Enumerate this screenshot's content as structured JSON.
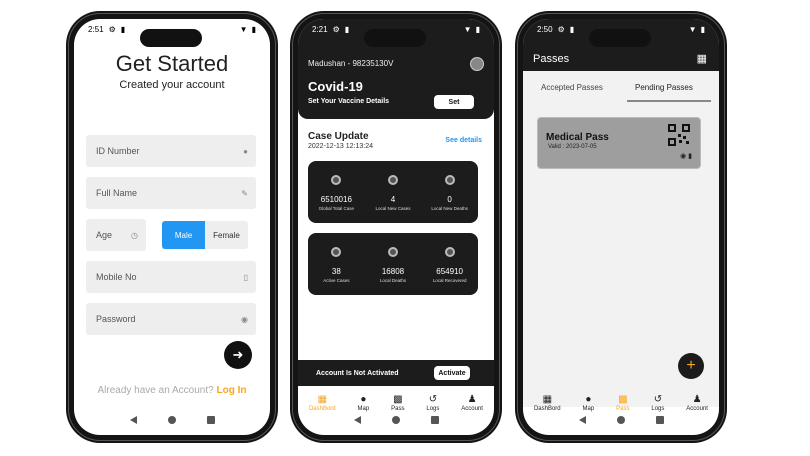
{
  "screens": {
    "signup": {
      "status": {
        "time": "2:51"
      },
      "title": "Get Started",
      "subtitle": "Created your account",
      "fields": {
        "id_number": "ID Number",
        "full_name": "Full Name",
        "age": "Age",
        "mobile": "Mobile No",
        "password": "Password"
      },
      "gender": {
        "male": "Male",
        "female": "Female",
        "selected": "Male"
      },
      "login_prompt": "Already have an Account?",
      "login_link": "Log In"
    },
    "dashboard": {
      "status": {
        "time": "2:21"
      },
      "user": "Madushan -   98235130V",
      "title": "Covid-19",
      "vaccine_label": "Set Your Vaccine Details",
      "set_button": "Set",
      "case_update": {
        "title": "Case Update",
        "date": "2022-12-13 12:13:24",
        "details_link": "See details"
      },
      "stats_row1": [
        {
          "value": "6510016",
          "label": "Global Total Case"
        },
        {
          "value": "4",
          "label": "Local New Cases"
        },
        {
          "value": "0",
          "label": "Local New Deaths"
        }
      ],
      "stats_row2": [
        {
          "value": "38",
          "label": "Active Cases"
        },
        {
          "value": "16808",
          "label": "Local Deaths"
        },
        {
          "value": "654910",
          "label": "Local Recovered"
        }
      ],
      "activation": {
        "text": "Account Is Not Activated",
        "button": "Activate"
      },
      "nav": [
        {
          "label": "DashBord",
          "icon": "dashboard-icon",
          "active": true
        },
        {
          "label": "Map",
          "icon": "map-pin-icon",
          "active": false
        },
        {
          "label": "Pass",
          "icon": "qr-icon",
          "active": false
        },
        {
          "label": "Logs",
          "icon": "history-icon",
          "active": false
        },
        {
          "label": "Account",
          "icon": "person-icon",
          "active": false
        }
      ]
    },
    "passes": {
      "status": {
        "time": "2:50"
      },
      "title": "Passes",
      "tabs": {
        "accepted": "Accepted Passes",
        "pending": "Pending Passes",
        "selected": "Pending Passes"
      },
      "card": {
        "name": "Medical Pass",
        "valid": "Valid : 2023-07-05"
      },
      "fab": "+",
      "nav": [
        {
          "label": "DashBord",
          "icon": "dashboard-icon",
          "active": false
        },
        {
          "label": "Map",
          "icon": "map-pin-icon",
          "active": false
        },
        {
          "label": "Pass",
          "icon": "qr-icon",
          "active": true
        },
        {
          "label": "Logs",
          "icon": "history-icon",
          "active": false
        },
        {
          "label": "Account",
          "icon": "person-icon",
          "active": false
        }
      ]
    }
  },
  "colors": {
    "accent": "#f5a623",
    "primary": "#2196f3",
    "dark": "#1c1c1c"
  }
}
